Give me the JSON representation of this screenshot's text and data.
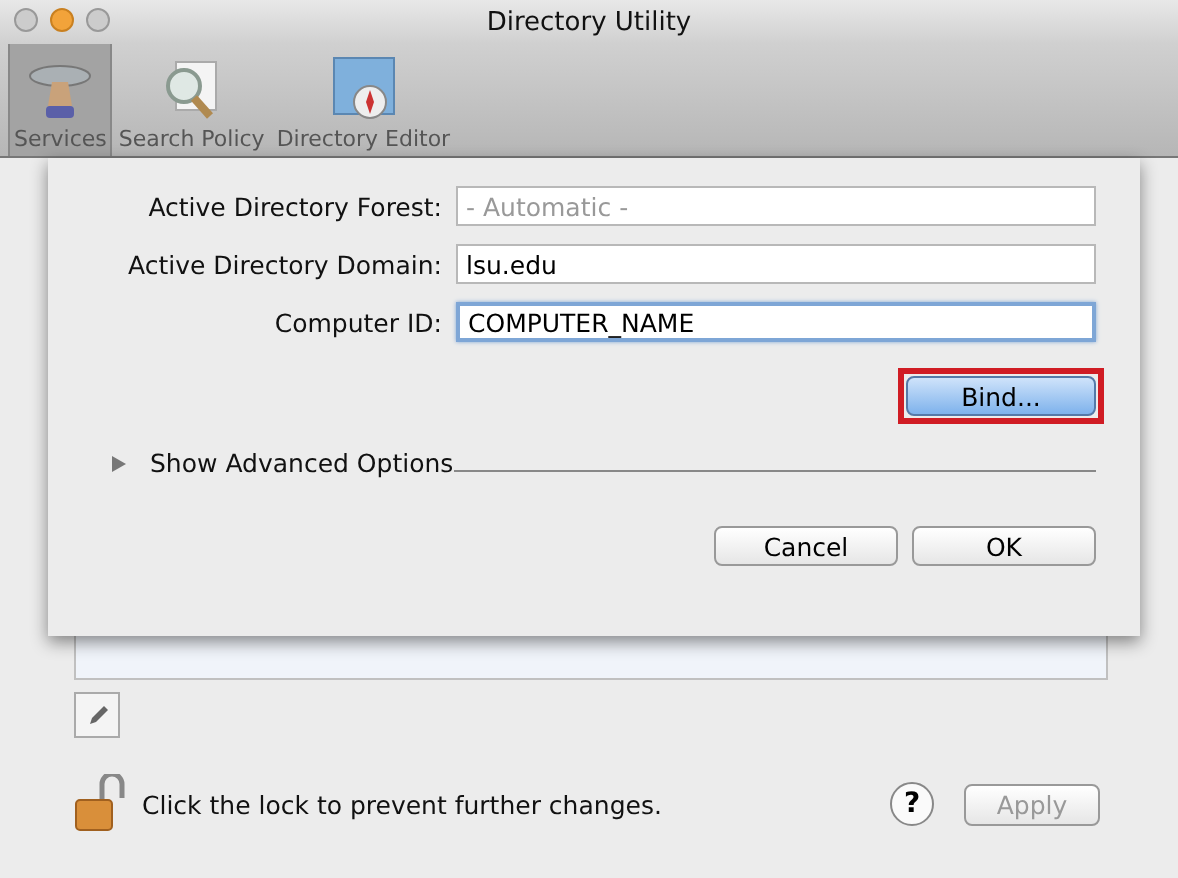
{
  "window": {
    "title": "Directory Utility"
  },
  "toolbar": [
    {
      "label": "Services",
      "selected": true,
      "kind": "services"
    },
    {
      "label": "Search Policy",
      "selected": false,
      "kind": "search"
    },
    {
      "label": "Directory Editor",
      "selected": false,
      "kind": "editor"
    }
  ],
  "sheet": {
    "fields": [
      {
        "label": "Active Directory Forest:",
        "placeholder": "- Automatic -",
        "focused": false
      },
      {
        "label": "Active Directory Domain:",
        "value": "lsu.edu",
        "focused": false
      },
      {
        "label": "Computer ID:",
        "value": "COMPUTER_NAME",
        "focused": true
      }
    ],
    "bind_button": {
      "label": "Bind...",
      "highlighted": true
    },
    "advanced": {
      "label": "Show Advanced Options",
      "expanded": false
    },
    "buttons": [
      {
        "label": "Cancel",
        "default": false
      },
      {
        "label": "OK",
        "default": false
      }
    ]
  },
  "lock_text": "Click the lock to prevent further changes.",
  "help": "?",
  "apply": {
    "label": "Apply",
    "disabled": true
  }
}
